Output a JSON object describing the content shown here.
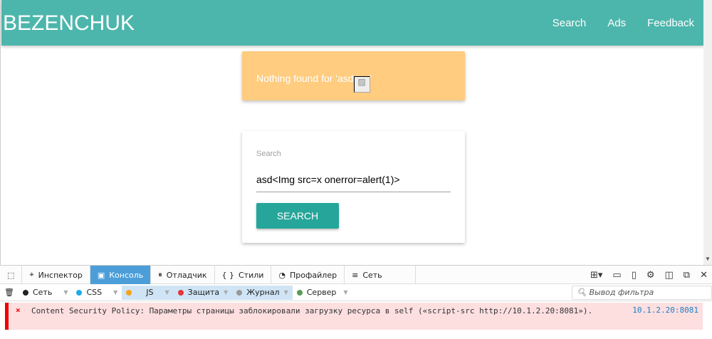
{
  "nav": {
    "brand": "BEZENCHUK",
    "links": [
      "Search",
      "Ads",
      "Feedback"
    ]
  },
  "alert": {
    "text": "Nothing found for 'asd",
    "suffix": "'"
  },
  "search_card": {
    "label": "Search",
    "value": "asd<Img src=x onerror=alert(1)>",
    "button": "SEARCH"
  },
  "devtools": {
    "tabs": [
      {
        "icon": "⌖",
        "label": "Инспектор"
      },
      {
        "icon": "▣",
        "label": "Консоль"
      },
      {
        "icon": "⏸",
        "label": "Отладчик"
      },
      {
        "icon": "{ }",
        "label": "Стили"
      },
      {
        "icon": "◔",
        "label": "Профайлер"
      },
      {
        "icon": "≡",
        "label": "Сеть"
      }
    ],
    "filters": [
      {
        "label": "Сеть",
        "color": "#222222",
        "on": false
      },
      {
        "label": "CSS",
        "color": "#1eaae7",
        "on": false
      },
      {
        "label": "JS",
        "color": "#f5a31b",
        "on": true
      },
      {
        "label": "Защита",
        "color": "#e6363e",
        "on": true
      },
      {
        "label": "Журнал",
        "color": "#999999",
        "on": true
      },
      {
        "label": "Сервер",
        "color": "#5b9b55",
        "on": false
      }
    ],
    "filter_placeholder": "Вывод фильтра",
    "message": {
      "text": "Content Security Policy: Параметры страницы заблокировали загрузку ресурса в self («script-src http://10.1.2.20:8081»).",
      "source": "10.1.2.20:8081"
    }
  }
}
